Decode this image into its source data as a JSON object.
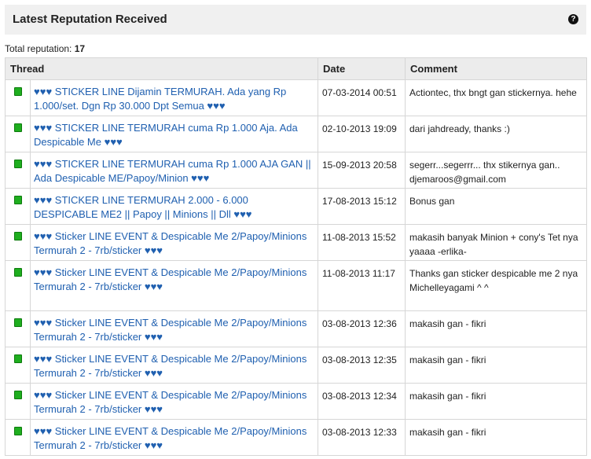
{
  "header": {
    "title": "Latest Reputation Received",
    "help_icon": "?"
  },
  "total": {
    "label": "Total reputation:",
    "value": "17"
  },
  "columns": {
    "thread": "Thread",
    "date": "Date",
    "comment": "Comment"
  },
  "rows": [
    {
      "status": "green",
      "thread": "♥♥♥ STICKER LINE Dijamin TERMURAH. Ada yang Rp 1.000/set. Dgn Rp 30.000 Dpt Semua ♥♥♥",
      "date": "07-03-2014 00:51",
      "comment": [
        "Actiontec, thx bngt gan stickernya. hehe"
      ]
    },
    {
      "status": "green",
      "thread": "♥♥♥ STICKER LINE TERMURAH cuma Rp 1.000 Aja. Ada Despicable Me ♥♥♥",
      "date": "02-10-2013 19:09",
      "comment": [
        "dari jahdready, thanks :)"
      ]
    },
    {
      "status": "green",
      "thread": "♥♥♥ STICKER LINE TERMURAH cuma Rp 1.000 AJA GAN || Ada Despicable ME/Papoy/Minion ♥♥♥",
      "date": "15-09-2013 20:58",
      "comment": [
        "segerr...segerrr... thx stikernya gan..",
        "djemaroos@gmail.com"
      ]
    },
    {
      "status": "green",
      "thread": "♥♥♥ STICKER LINE TERMURAH 2.000 - 6.000 DESPICABLE ME2 || Papoy || Minions || Dll ♥♥♥",
      "date": "17-08-2013 15:12",
      "comment": [
        "Bonus gan"
      ]
    },
    {
      "status": "green",
      "thread": "♥♥♥ Sticker LINE EVENT & Despicable Me 2/Papoy/Minions Termurah 2 - 7rb/sticker ♥♥♥",
      "date": "11-08-2013 15:52",
      "comment": [
        "makasih banyak Minion + cony's Tet nya yaaaa -erlika-"
      ]
    },
    {
      "status": "green",
      "thread": "♥♥♥ Sticker LINE EVENT & Despicable Me 2/Papoy/Minions Termurah 2 - 7rb/sticker ♥♥♥",
      "date": "11-08-2013 11:17",
      "comment": [
        "Thanks gan sticker despicable me 2 nya",
        "Michelleyagami ^ ^"
      ]
    },
    {
      "status": "green",
      "thread": "♥♥♥ Sticker LINE EVENT & Despicable Me 2/Papoy/Minions Termurah 2 - 7rb/sticker ♥♥♥",
      "date": "03-08-2013 12:36",
      "comment": [
        "makasih gan - fikri"
      ]
    },
    {
      "status": "green",
      "thread": "♥♥♥ Sticker LINE EVENT & Despicable Me 2/Papoy/Minions Termurah 2 - 7rb/sticker ♥♥♥",
      "date": "03-08-2013 12:35",
      "comment": [
        "makasih gan - fikri"
      ]
    },
    {
      "status": "green",
      "thread": "♥♥♥ Sticker LINE EVENT & Despicable Me 2/Papoy/Minions Termurah 2 - 7rb/sticker ♥♥♥",
      "date": "03-08-2013 12:34",
      "comment": [
        "makasih gan - fikri"
      ]
    },
    {
      "status": "green",
      "thread": "♥♥♥ Sticker LINE EVENT & Despicable Me 2/Papoy/Minions Termurah 2 - 7rb/sticker ♥♥♥",
      "date": "03-08-2013 12:33",
      "comment": [
        "makasih gan - fikri"
      ]
    }
  ]
}
